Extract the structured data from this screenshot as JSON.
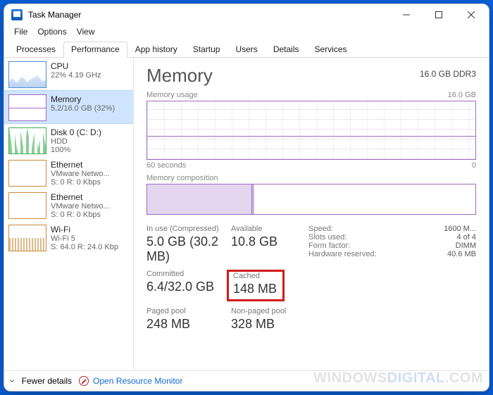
{
  "window": {
    "title": "Task Manager"
  },
  "menu": {
    "file": "File",
    "options": "Options",
    "view": "View"
  },
  "tabs": [
    {
      "label": "Processes"
    },
    {
      "label": "Performance",
      "active": true
    },
    {
      "label": "App history"
    },
    {
      "label": "Startup"
    },
    {
      "label": "Users"
    },
    {
      "label": "Details"
    },
    {
      "label": "Services"
    }
  ],
  "sidebar": {
    "items": [
      {
        "name": "CPU",
        "sub1": "22%  4.19 GHz"
      },
      {
        "name": "Memory",
        "sub1": "5.2/16.0 GB (32%)",
        "selected": true
      },
      {
        "name": "Disk 0 (C: D:)",
        "sub1": "HDD",
        "sub2": "100%"
      },
      {
        "name": "Ethernet",
        "sub1": "VMware Netwo...",
        "sub2": "S: 0  R: 0 Kbps"
      },
      {
        "name": "Ethernet",
        "sub1": "VMware Netwo...",
        "sub2": "S: 0  R: 0 Kbps"
      },
      {
        "name": "Wi-Fi",
        "sub1": "Wi-Fi 5",
        "sub2": "S: 64.0  R: 24.0 Kbp"
      }
    ]
  },
  "footer": {
    "fewer": "Fewer details",
    "orm": "Open Resource Monitor"
  },
  "main": {
    "title": "Memory",
    "total": "16.0 GB DDR3",
    "usage_label": "Memory usage",
    "usage_max": "16.0 GB",
    "axis_left": "60 seconds",
    "axis_right": "0",
    "comp_label": "Memory composition",
    "stats": {
      "inuse_label": "In use (Compressed)",
      "inuse_value": "5.0 GB (30.2 MB)",
      "available_label": "Available",
      "available_value": "10.8 GB",
      "committed_label": "Committed",
      "committed_value": "6.4/32.0 GB",
      "cached_label": "Cached",
      "cached_value": "148 MB",
      "paged_label": "Paged pool",
      "paged_value": "248 MB",
      "nonpaged_label": "Non-paged pool",
      "nonpaged_value": "328 MB"
    },
    "kv": {
      "speed_k": "Speed:",
      "speed_v": "1600 M...",
      "slots_k": "Slots used:",
      "slots_v": "4 of 4",
      "form_k": "Form factor:",
      "form_v": "DIMM",
      "hw_k": "Hardware reserved:",
      "hw_v": "40.6 MB"
    }
  },
  "watermark": {
    "a": "Windows",
    "b": "Digital",
    "c": ".com"
  }
}
